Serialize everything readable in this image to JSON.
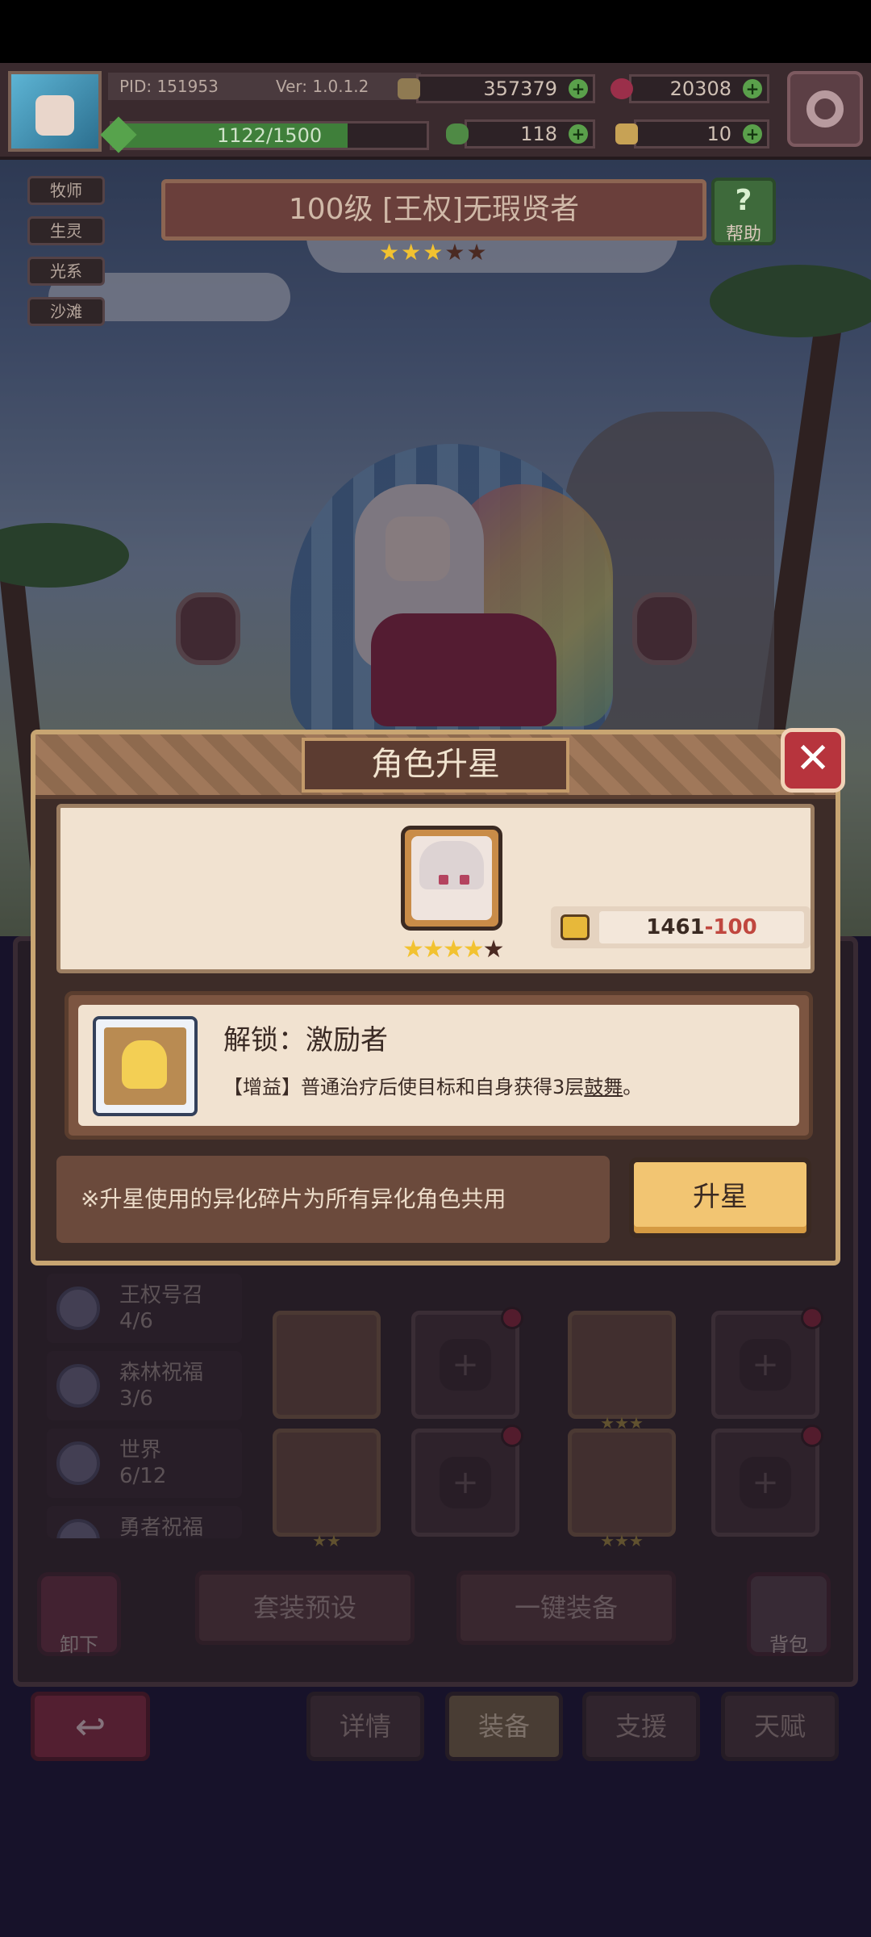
{
  "hud": {
    "pid": "PID: 151953",
    "version": "Ver: 1.0.1.2",
    "gold": "357379",
    "gems": "20308",
    "clover": "118",
    "keys": "10",
    "exp_text": "1122/1500",
    "exp_progress": 0.748
  },
  "tags": [
    "牧师",
    "生灵",
    "光系",
    "沙滩"
  ],
  "hero": {
    "title": "100级 [王权]无瑕贤者",
    "stars_filled": 3,
    "stars_total": 5
  },
  "help": {
    "label": "帮助",
    "glyph": "?"
  },
  "modal": {
    "title": "角色升星",
    "close_glyph": "✕",
    "shards_have": "1461",
    "shards_cost": "-100",
    "unlock_title": "解锁：激励者",
    "unlock_desc_prefix": "【增益】普通治疗后使目标和自身获得3层",
    "unlock_desc_keyword": "鼓舞",
    "unlock_desc_suffix": "。",
    "note": "※升星使用的异化碎片为所有异化角色共用",
    "star_up_label": "升星"
  },
  "sets": [
    {
      "name": "王权号召",
      "count": "4/6"
    },
    {
      "name": "森林祝福",
      "count": "3/6"
    },
    {
      "name": "世界",
      "count": "6/12"
    },
    {
      "name": "勇者祝福",
      "count": ""
    }
  ],
  "actions": {
    "unequip": "卸下",
    "preset": "套装预设",
    "auto_equip": "一键装备",
    "bag": "背包"
  },
  "tabs": [
    "详情",
    "装备",
    "支援",
    "天赋"
  ],
  "active_tab": "装备",
  "colors": {
    "accent_gold": "#f2c572",
    "close_red": "#b7343d",
    "cost_red": "#c0473f",
    "star_gold": "#f2c230"
  }
}
